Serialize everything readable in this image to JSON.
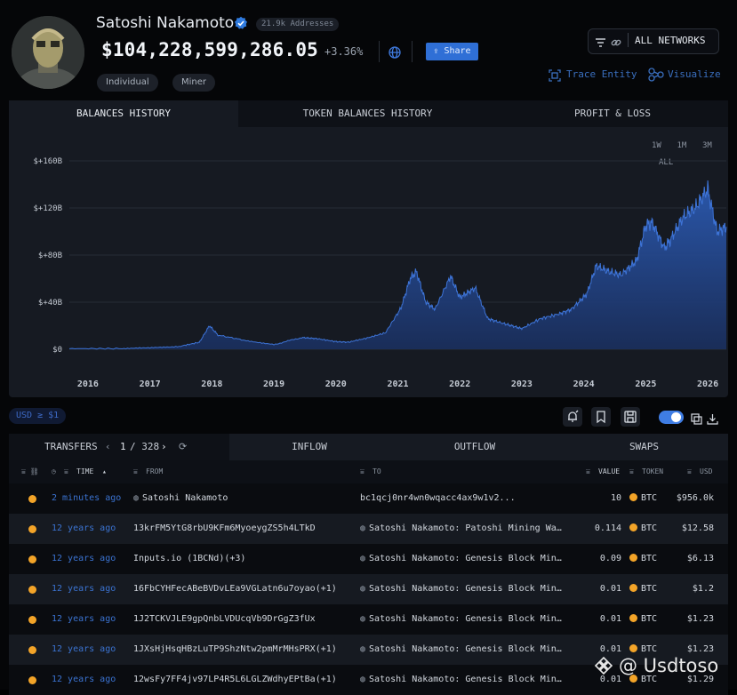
{
  "entity": {
    "name": "Satoshi Nakamoto",
    "addresses_badge": "21.9k Addresses",
    "balance": "$104,228,599,286.05",
    "change": "+3.36%",
    "share_label": "Share",
    "tags": [
      "Individual",
      "Miner"
    ]
  },
  "actions": {
    "networks_label": "ALL NETWORKS",
    "trace_label": "Trace Entity",
    "visualize_label": "Visualize"
  },
  "chart_tabs": [
    "BALANCES HISTORY",
    "TOKEN BALANCES HISTORY",
    "PROFIT & LOSS"
  ],
  "time_ranges": [
    "1W",
    "1M",
    "3M",
    "ALL"
  ],
  "chart_data": {
    "type": "area",
    "xlabel": "",
    "ylabel": "",
    "x_ticks": [
      "2016",
      "2017",
      "2018",
      "2019",
      "2020",
      "2021",
      "2022",
      "2023",
      "2024",
      "2025",
      "2026"
    ],
    "y_ticks": [
      "$0",
      "$+40B",
      "$+80B",
      "$+120B",
      "$+160B"
    ],
    "ylim": [
      0,
      160
    ],
    "y_unit": "B USD",
    "x": [
      2015.7,
      2016.5,
      2017.0,
      2017.5,
      2017.8,
      2017.96,
      2018.1,
      2018.5,
      2019.0,
      2019.45,
      2019.7,
      2020.0,
      2020.2,
      2020.5,
      2020.8,
      2021.05,
      2021.2,
      2021.3,
      2021.45,
      2021.6,
      2021.85,
      2022.0,
      2022.25,
      2022.45,
      2022.7,
      2022.9,
      2023.0,
      2023.3,
      2023.6,
      2023.8,
      2024.05,
      2024.2,
      2024.4,
      2024.6,
      2024.85,
      2025.0,
      2025.1,
      2025.3,
      2025.4,
      2025.6,
      2025.8,
      2026.0,
      2026.15,
      2026.3
    ],
    "values": [
      0.5,
      0.6,
      1.0,
      2.7,
      6.0,
      20.0,
      12.0,
      8.0,
      4.0,
      10.0,
      9.0,
      6.5,
      6.0,
      9.5,
      14.0,
      35.0,
      60.0,
      66.0,
      40.0,
      34.0,
      62.0,
      44.0,
      52.0,
      26.0,
      22.0,
      19.0,
      17.5,
      26.0,
      30.0,
      34.0,
      47.0,
      71.0,
      66.0,
      63.0,
      75.0,
      105.0,
      108.0,
      86.0,
      93.0,
      112.0,
      120.0,
      136.0,
      100.0,
      104.0
    ],
    "grid": true
  },
  "table": {
    "tabs": [
      "TRANSFERS",
      "INFLOW",
      "OUTFLOW",
      "SWAPS"
    ],
    "page_current": "1",
    "page_total": "/ 328",
    "filter_badge": "USD ≥ $1",
    "headers": {
      "time": "TIME",
      "from": "FROM",
      "to": "TO",
      "value": "VALUE",
      "token": "TOKEN",
      "usd": "USD"
    },
    "rows": [
      {
        "time": "2 minutes ago",
        "from": "Satoshi Nakamoto",
        "from_entity": true,
        "to": "bc1qcj0nr4wn0wqacc4ax9w1v2...",
        "to_entity": false,
        "value": "10",
        "token": "BTC",
        "usd": "$956.0k"
      },
      {
        "time": "12 years ago",
        "from": "13krFM5YtG8rbU9KFm6MyoeygZS5h4LTkD",
        "from_entity": false,
        "to": "Satoshi Nakamoto: Patoshi Mining Wa…",
        "to_entity": true,
        "value": "0.114",
        "token": "BTC",
        "usd": "$12.58"
      },
      {
        "time": "12 years ago",
        "from": "Inputs.io (1BCNd)(+3)",
        "from_entity": false,
        "to": "Satoshi Nakamoto: Genesis Block Min…",
        "to_entity": true,
        "value": "0.09",
        "token": "BTC",
        "usd": "$6.13"
      },
      {
        "time": "12 years ago",
        "from": "16FbCYHFecABeBVDvLEa9VGLatn6u7oyao(+1)",
        "from_entity": false,
        "to": "Satoshi Nakamoto: Genesis Block Min…",
        "to_entity": true,
        "value": "0.01",
        "token": "BTC",
        "usd": "$1.2"
      },
      {
        "time": "12 years ago",
        "from": "1J2TCKVJLE9gpQnbLVDUcqVb9DrGgZ3fUx",
        "from_entity": false,
        "to": "Satoshi Nakamoto: Genesis Block Min…",
        "to_entity": true,
        "value": "0.01",
        "token": "BTC",
        "usd": "$1.23"
      },
      {
        "time": "12 years ago",
        "from": "1JXsHjHsqHBzLuTP9ShzNtw2pmMrMHsPRX(+1)",
        "from_entity": false,
        "to": "Satoshi Nakamoto: Genesis Block Min…",
        "to_entity": true,
        "value": "0.01",
        "token": "BTC",
        "usd": "$1.23"
      },
      {
        "time": "12 years ago",
        "from": "12wsFy7FF4jv97LP4R5L6LGLZWdhyEPtBa(+1)",
        "from_entity": false,
        "to": "Satoshi Nakamoto: Genesis Block Min…",
        "to_entity": true,
        "value": "0.01",
        "token": "BTC",
        "usd": "$1.29"
      }
    ]
  },
  "watermark": "@ Usdtoso",
  "colors": {
    "accent": "#2f6fd6",
    "link": "#3b73d1",
    "btc": "#f3a428",
    "area_top": "#2c5bb3"
  }
}
